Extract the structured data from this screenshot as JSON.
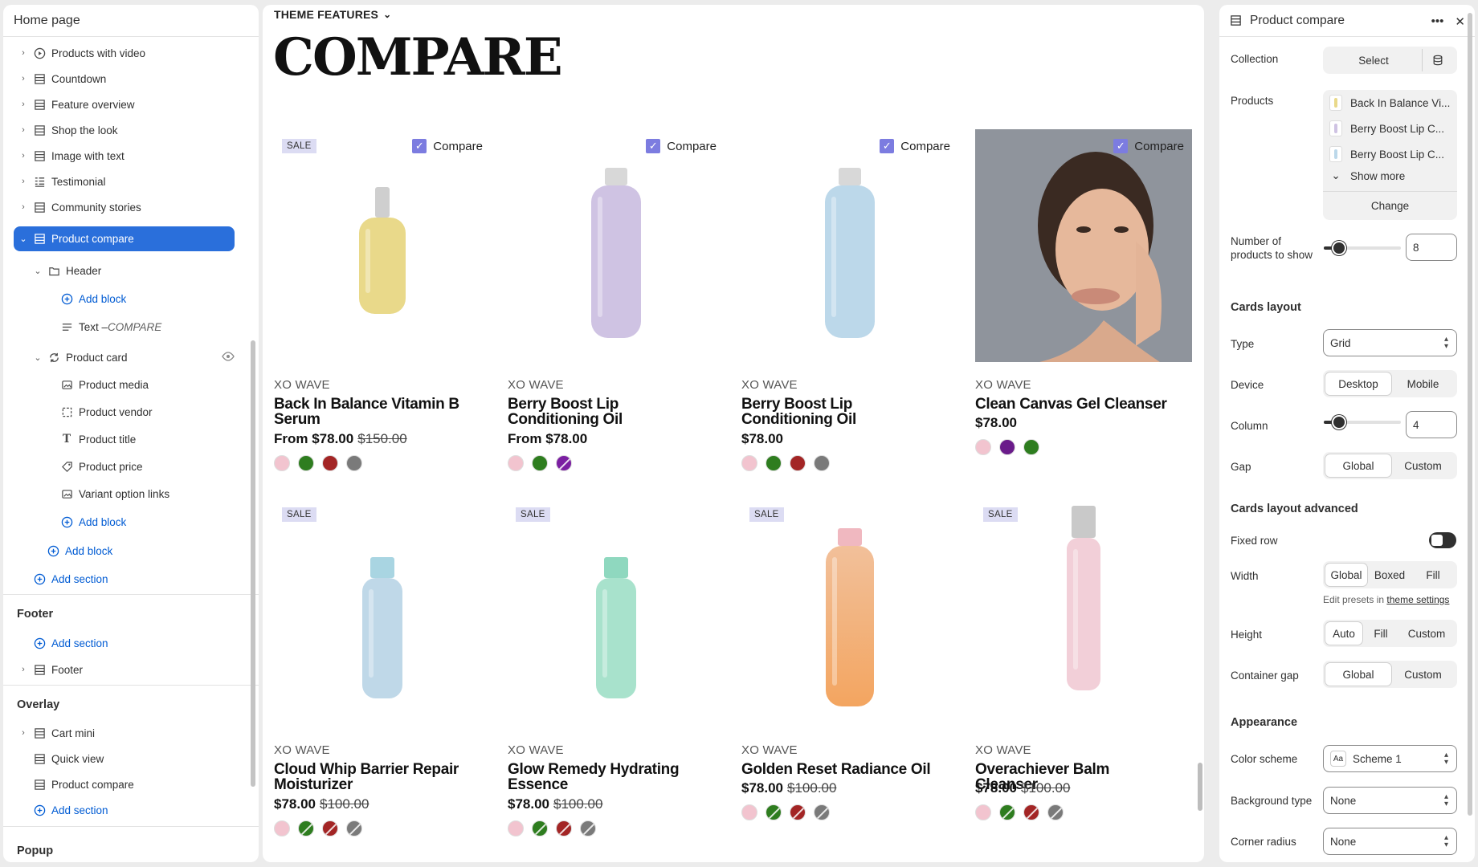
{
  "left_panel": {
    "title": "Home page",
    "items": [
      {
        "label": "Products with video",
        "icon": "play-circle-icon"
      },
      {
        "label": "Countdown",
        "icon": "section-icon"
      },
      {
        "label": "Feature overview",
        "icon": "section-icon"
      },
      {
        "label": "Shop the look",
        "icon": "section-icon"
      },
      {
        "label": "Image with text",
        "icon": "section-icon"
      },
      {
        "label": "Testimonial",
        "icon": "list-icon"
      },
      {
        "label": "Community stories",
        "icon": "section-icon"
      },
      {
        "label": "Product compare",
        "icon": "section-icon"
      }
    ],
    "header_block": "Header",
    "add_block": "Add block",
    "text_block_prefix": "Text – ",
    "text_block_value": "COMPARE",
    "product_card": "Product card",
    "card_blocks": [
      "Product media",
      "Product vendor",
      "Product title",
      "Product price",
      "Variant option links"
    ],
    "add_section": "Add section",
    "footer_group": "Footer",
    "footer_item": "Footer",
    "overlay_group": "Overlay",
    "overlay_items": [
      "Cart mini",
      "Quick view",
      "Product compare"
    ],
    "popup_group": "Popup"
  },
  "canvas": {
    "theme_features": "THEME FEATURES",
    "title": "COMPARE",
    "compare_label": "Compare",
    "sale_label": "SALE",
    "products": [
      {
        "vendor": "XO WAVE",
        "title": "Back In Balance Vitamin B Serum",
        "price": "From $78.00",
        "old_price": "$150.00",
        "sale": true,
        "compare": true,
        "swatches": [
          "#f2c4cf",
          "#2e7d1f",
          "#a32525",
          "#7a7a7a"
        ],
        "bottle": {
          "color": "#e9d98a",
          "cap": "#cfcfcf",
          "shape": "pump"
        }
      },
      {
        "vendor": "XO WAVE",
        "title": "Berry Boost Lip Conditioning Oil",
        "price": "From $78.00",
        "old_price": "",
        "sale": false,
        "compare": true,
        "swatches": [
          "#f2c4cf",
          "#2e7d1f",
          "#7b1fa2"
        ],
        "bottle": {
          "color": "#cfc3e3",
          "cap": "#d8d8d8",
          "shape": "tall"
        }
      },
      {
        "vendor": "XO WAVE",
        "title": "Berry Boost Lip Conditioning Oil",
        "price": "$78.00",
        "old_price": "",
        "sale": false,
        "compare": true,
        "swatches": [
          "#f2c4cf",
          "#2e7d1f",
          "#a32525",
          "#7a7a7a"
        ],
        "bottle": {
          "color": "#bcd8ea",
          "cap": "#d8d8d8",
          "shape": "tall"
        }
      },
      {
        "vendor": "XO WAVE",
        "title": "Clean Canvas Gel Cleanser",
        "price": "$78.00",
        "old_price": "",
        "sale": false,
        "compare": true,
        "swatches": [
          "#f2c4cf",
          "#6a1b8a",
          "#2e7d1f"
        ],
        "bottle": {
          "shape": "photo"
        }
      },
      {
        "vendor": "XO WAVE",
        "title": "Cloud Whip Barrier Repair Moisturizer",
        "price": "$78.00",
        "old_price": "$100.00",
        "sale": true,
        "compare": false,
        "swatches": [
          "#f2c4cf",
          "#2e7d1f",
          "#a32525",
          "#7a7a7a"
        ],
        "bottle": {
          "color": "#bfd8e8",
          "cap": "#a9d5e2",
          "shape": "short"
        }
      },
      {
        "vendor": "XO WAVE",
        "title": "Glow Remedy Hydrating Essence",
        "price": "$78.00",
        "old_price": "$100.00",
        "sale": true,
        "compare": false,
        "swatches": [
          "#f2c4cf",
          "#2e7d1f",
          "#a32525",
          "#7a7a7a"
        ],
        "bottle": {
          "color": "#a8e2cc",
          "cap": "#8fd8bf",
          "shape": "short"
        }
      },
      {
        "vendor": "XO WAVE",
        "title": "Golden Reset Radiance Oil",
        "price": "$78.00",
        "old_price": "$100.00",
        "sale": true,
        "compare": false,
        "swatches": [
          "#f2c4cf",
          "#2e7d1f",
          "#a32525",
          "#7a7a7a"
        ],
        "bottle": {
          "color": "#f2c09a",
          "cap": "#f0b8c0",
          "shape": "tallgrad"
        }
      },
      {
        "vendor": "XO WAVE",
        "title": "Overachiever Balm Cleanser",
        "price": "$78.00",
        "old_price": "$100.00",
        "sale": true,
        "compare": false,
        "swatches": [
          "#f2c4cf",
          "#2e7d1f",
          "#a32525",
          "#7a7a7a"
        ],
        "bottle": {
          "color": "#f2cfd8",
          "cap": "#c9c9c9",
          "shape": "slim"
        }
      }
    ]
  },
  "right_panel": {
    "title": "Product compare",
    "collection_label": "Collection",
    "select_btn": "Select",
    "products_label": "Products",
    "product_list": [
      "Back In Balance Vi...",
      "Berry Boost Lip C...",
      "Berry Boost Lip C..."
    ],
    "show_more": "Show more",
    "change_btn": "Change",
    "num_label": "Number of products to show",
    "num_value": "8",
    "num_fraction": 0.2,
    "cards_layout": "Cards layout",
    "type_label": "Type",
    "type_value": "Grid",
    "device_label": "Device",
    "device_opts": [
      "Desktop",
      "Mobile"
    ],
    "column_label": "Column",
    "column_value": "4",
    "column_fraction": 0.2,
    "gap_label": "Gap",
    "gap_opts": [
      "Global",
      "Custom"
    ],
    "cla": "Cards layout advanced",
    "fixed_row": "Fixed row",
    "width_label": "Width",
    "width_opts": [
      "Global",
      "Boxed",
      "Fill"
    ],
    "presets_text": "Edit presets in",
    "presets_link": "theme settings",
    "height_label": "Height",
    "height_opts": [
      "Auto",
      "Fill",
      "Custom"
    ],
    "container_gap": "Container gap",
    "cg_opts": [
      "Global",
      "Custom"
    ],
    "appearance": "Appearance",
    "color_scheme": "Color scheme",
    "scheme_value": "Scheme 1",
    "scheme_badge": "Aa",
    "bg_type": "Background type",
    "bg_value": "None",
    "corner": "Corner radius",
    "corner_value": "None"
  }
}
